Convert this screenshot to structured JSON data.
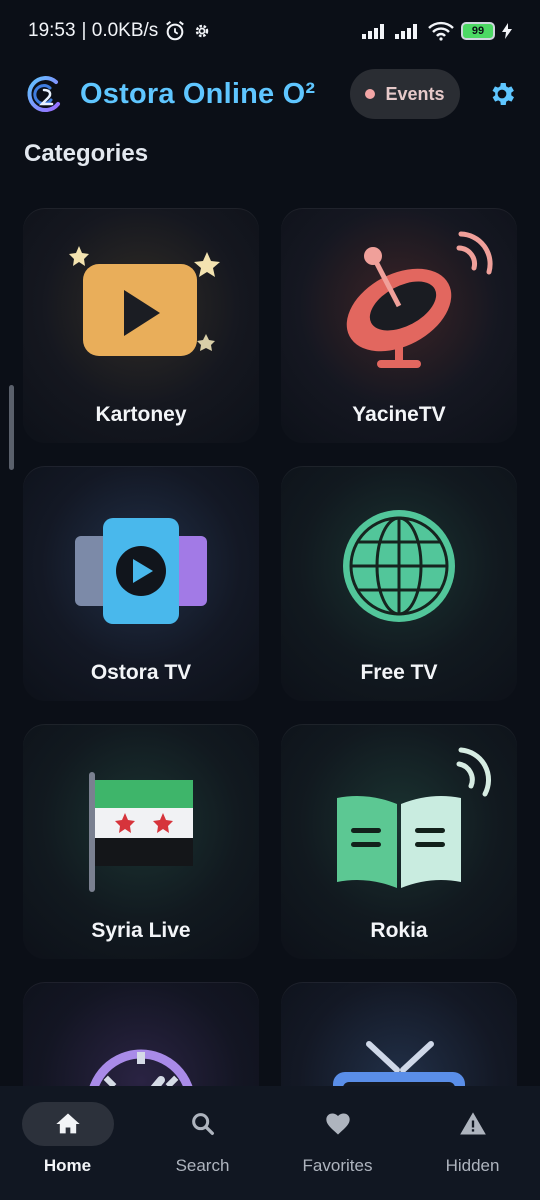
{
  "status_bar": {
    "time": "19:53",
    "network_speed": "| 0.0KB/s",
    "battery_level": "99",
    "icons": [
      "alarm-icon",
      "settings-gear-icon",
      "signal-icon",
      "signal-icon",
      "wifi-icon",
      "battery-icon",
      "charging-icon"
    ]
  },
  "header": {
    "title": "Ostora Online O²",
    "events_label": "Events",
    "title_color": "#5fc6ff"
  },
  "section": {
    "title": "Categories"
  },
  "categories": [
    {
      "label": "Kartoney",
      "icon": "play-button-icon"
    },
    {
      "label": "YacineTV",
      "icon": "satellite-dish-icon"
    },
    {
      "label": "Ostora TV",
      "icon": "video-stack-icon"
    },
    {
      "label": "Free TV",
      "icon": "globe-icon"
    },
    {
      "label": "Syria Live",
      "icon": "syria-flag-icon"
    },
    {
      "label": "Rokia",
      "icon": "book-broadcast-icon"
    },
    {
      "label": "",
      "icon": "stopwatch-icon"
    },
    {
      "label": "",
      "icon": "tv-globe-icon"
    }
  ],
  "bottom_nav": {
    "items": [
      {
        "label": "Home",
        "icon": "home-icon",
        "active": true
      },
      {
        "label": "Search",
        "icon": "search-icon",
        "active": false
      },
      {
        "label": "Favorites",
        "icon": "heart-icon",
        "active": false
      },
      {
        "label": "Hidden",
        "icon": "warning-icon",
        "active": false
      }
    ]
  },
  "colors": {
    "background": "#0b0f17",
    "accent": "#5fc6ff",
    "nav_background": "#111722"
  }
}
